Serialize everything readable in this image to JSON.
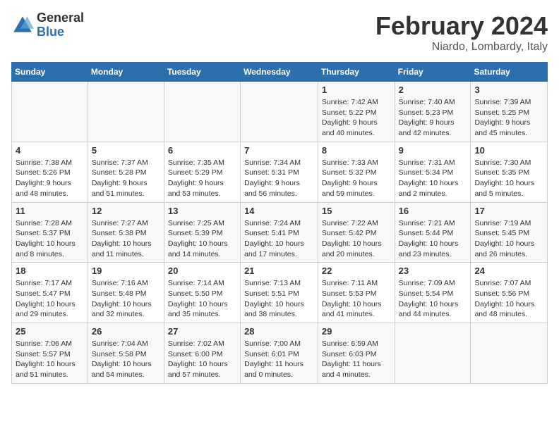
{
  "header": {
    "logo_general": "General",
    "logo_blue": "Blue",
    "month_title": "February 2024",
    "location": "Niardo, Lombardy, Italy"
  },
  "weekdays": [
    "Sunday",
    "Monday",
    "Tuesday",
    "Wednesday",
    "Thursday",
    "Friday",
    "Saturday"
  ],
  "weeks": [
    [
      {
        "day": "",
        "info": ""
      },
      {
        "day": "",
        "info": ""
      },
      {
        "day": "",
        "info": ""
      },
      {
        "day": "",
        "info": ""
      },
      {
        "day": "1",
        "info": "Sunrise: 7:42 AM\nSunset: 5:22 PM\nDaylight: 9 hours and 40 minutes."
      },
      {
        "day": "2",
        "info": "Sunrise: 7:40 AM\nSunset: 5:23 PM\nDaylight: 9 hours and 42 minutes."
      },
      {
        "day": "3",
        "info": "Sunrise: 7:39 AM\nSunset: 5:25 PM\nDaylight: 9 hours and 45 minutes."
      }
    ],
    [
      {
        "day": "4",
        "info": "Sunrise: 7:38 AM\nSunset: 5:26 PM\nDaylight: 9 hours and 48 minutes."
      },
      {
        "day": "5",
        "info": "Sunrise: 7:37 AM\nSunset: 5:28 PM\nDaylight: 9 hours and 51 minutes."
      },
      {
        "day": "6",
        "info": "Sunrise: 7:35 AM\nSunset: 5:29 PM\nDaylight: 9 hours and 53 minutes."
      },
      {
        "day": "7",
        "info": "Sunrise: 7:34 AM\nSunset: 5:31 PM\nDaylight: 9 hours and 56 minutes."
      },
      {
        "day": "8",
        "info": "Sunrise: 7:33 AM\nSunset: 5:32 PM\nDaylight: 9 hours and 59 minutes."
      },
      {
        "day": "9",
        "info": "Sunrise: 7:31 AM\nSunset: 5:34 PM\nDaylight: 10 hours and 2 minutes."
      },
      {
        "day": "10",
        "info": "Sunrise: 7:30 AM\nSunset: 5:35 PM\nDaylight: 10 hours and 5 minutes."
      }
    ],
    [
      {
        "day": "11",
        "info": "Sunrise: 7:28 AM\nSunset: 5:37 PM\nDaylight: 10 hours and 8 minutes."
      },
      {
        "day": "12",
        "info": "Sunrise: 7:27 AM\nSunset: 5:38 PM\nDaylight: 10 hours and 11 minutes."
      },
      {
        "day": "13",
        "info": "Sunrise: 7:25 AM\nSunset: 5:39 PM\nDaylight: 10 hours and 14 minutes."
      },
      {
        "day": "14",
        "info": "Sunrise: 7:24 AM\nSunset: 5:41 PM\nDaylight: 10 hours and 17 minutes."
      },
      {
        "day": "15",
        "info": "Sunrise: 7:22 AM\nSunset: 5:42 PM\nDaylight: 10 hours and 20 minutes."
      },
      {
        "day": "16",
        "info": "Sunrise: 7:21 AM\nSunset: 5:44 PM\nDaylight: 10 hours and 23 minutes."
      },
      {
        "day": "17",
        "info": "Sunrise: 7:19 AM\nSunset: 5:45 PM\nDaylight: 10 hours and 26 minutes."
      }
    ],
    [
      {
        "day": "18",
        "info": "Sunrise: 7:17 AM\nSunset: 5:47 PM\nDaylight: 10 hours and 29 minutes."
      },
      {
        "day": "19",
        "info": "Sunrise: 7:16 AM\nSunset: 5:48 PM\nDaylight: 10 hours and 32 minutes."
      },
      {
        "day": "20",
        "info": "Sunrise: 7:14 AM\nSunset: 5:50 PM\nDaylight: 10 hours and 35 minutes."
      },
      {
        "day": "21",
        "info": "Sunrise: 7:13 AM\nSunset: 5:51 PM\nDaylight: 10 hours and 38 minutes."
      },
      {
        "day": "22",
        "info": "Sunrise: 7:11 AM\nSunset: 5:53 PM\nDaylight: 10 hours and 41 minutes."
      },
      {
        "day": "23",
        "info": "Sunrise: 7:09 AM\nSunset: 5:54 PM\nDaylight: 10 hours and 44 minutes."
      },
      {
        "day": "24",
        "info": "Sunrise: 7:07 AM\nSunset: 5:56 PM\nDaylight: 10 hours and 48 minutes."
      }
    ],
    [
      {
        "day": "25",
        "info": "Sunrise: 7:06 AM\nSunset: 5:57 PM\nDaylight: 10 hours and 51 minutes."
      },
      {
        "day": "26",
        "info": "Sunrise: 7:04 AM\nSunset: 5:58 PM\nDaylight: 10 hours and 54 minutes."
      },
      {
        "day": "27",
        "info": "Sunrise: 7:02 AM\nSunset: 6:00 PM\nDaylight: 10 hours and 57 minutes."
      },
      {
        "day": "28",
        "info": "Sunrise: 7:00 AM\nSunset: 6:01 PM\nDaylight: 11 hours and 0 minutes."
      },
      {
        "day": "29",
        "info": "Sunrise: 6:59 AM\nSunset: 6:03 PM\nDaylight: 11 hours and 4 minutes."
      },
      {
        "day": "",
        "info": ""
      },
      {
        "day": "",
        "info": ""
      }
    ]
  ]
}
